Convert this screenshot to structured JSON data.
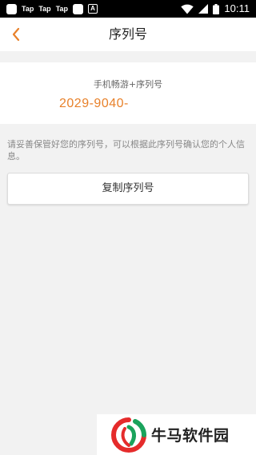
{
  "status_bar": {
    "notifications": [
      "Tap",
      "Tap",
      "Tap"
    ],
    "a_icon_letter": "A",
    "time": "10:11"
  },
  "header": {
    "title": "序列号",
    "accent_color": "#e8812a"
  },
  "serial": {
    "label": "手机畅游+序列号",
    "value": "2029-9040-"
  },
  "hint": "请妥善保管好您的序列号，可以根据此序列号确认您的个人信息。",
  "copy_button_label": "复制序列号",
  "watermark": {
    "text": "牛马软件园"
  }
}
